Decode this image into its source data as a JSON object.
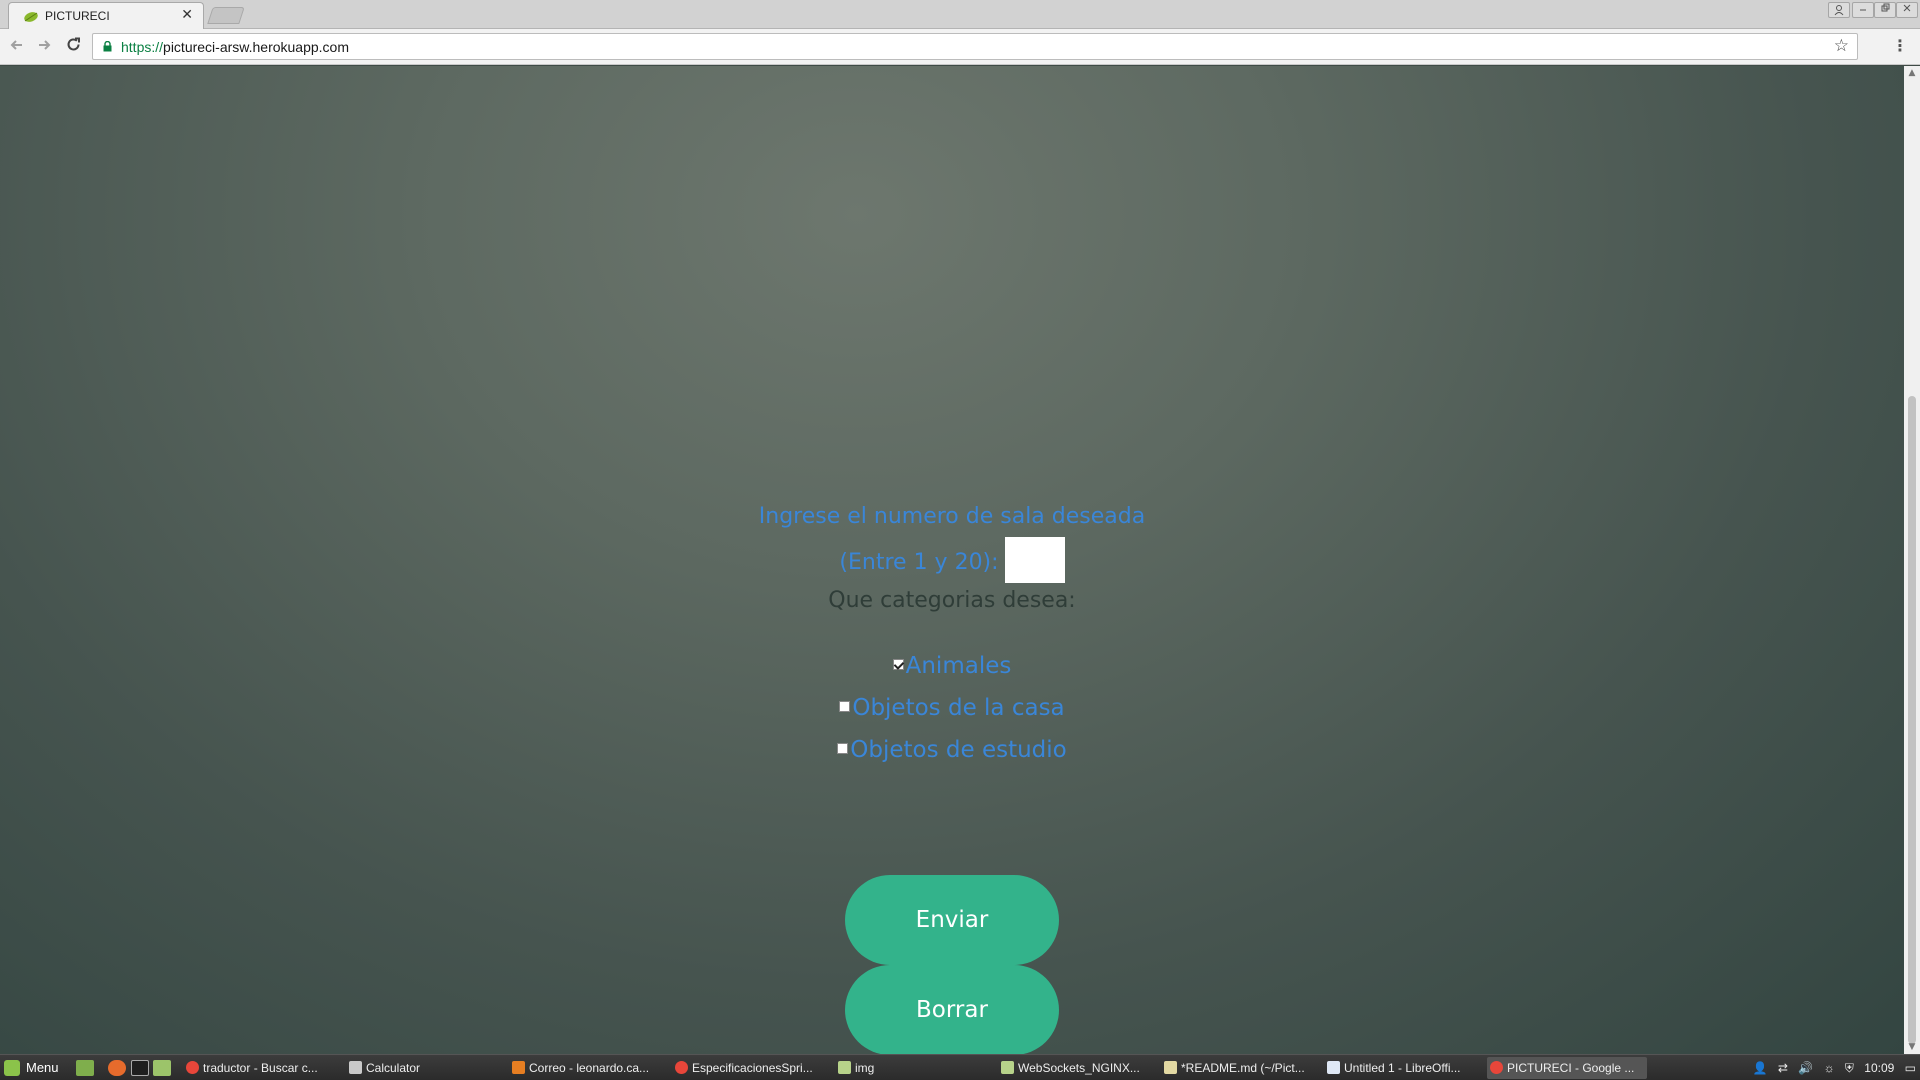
{
  "browser": {
    "tab_title": "PICTURECI",
    "url_scheme": "https://",
    "url_host": "pictureci-arsw.herokuapp.com",
    "tab_close_glyph": "✕"
  },
  "form": {
    "room_prompt": "Ingrese el numero de sala deseada",
    "room_range": "(Entre 1 y 20):",
    "room_value": "",
    "category_question": "Que categorias desea:",
    "categories": [
      {
        "label": "Animales",
        "checked": true
      },
      {
        "label": "Objetos de la casa",
        "checked": false
      },
      {
        "label": "Objetos de estudio",
        "checked": false
      }
    ],
    "send_label": "Enviar",
    "clear_label": "Borrar"
  },
  "taskbar": {
    "menu_label": "Menu",
    "tasks": [
      "traductor - Buscar c...",
      "Calculator",
      "Correo - leonardo.ca...",
      "EspecificacionesSpri...",
      "img",
      "WebSockets_NGINX...",
      "*README.md (~/Pict...",
      "Untitled 1 - LibreOffi...",
      "PICTURECI - Google ..."
    ],
    "clock": "10:09"
  },
  "colors": {
    "accent_button": "#33b38b",
    "form_text": "#3a86d8",
    "secure_url": "#0b8043"
  }
}
